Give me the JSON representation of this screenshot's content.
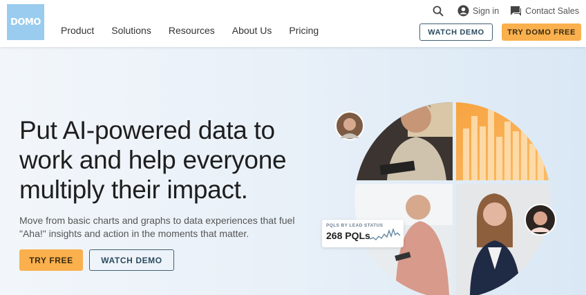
{
  "header": {
    "logo_text": "DOMO",
    "nav": [
      "Product",
      "Solutions",
      "Resources",
      "About Us",
      "Pricing"
    ],
    "search_icon": "search-icon",
    "signin_label": "Sign in",
    "contact_label": "Contact Sales",
    "watch_demo_label": "WATCH DEMO",
    "try_free_label": "TRY DOMO FREE"
  },
  "hero": {
    "headline": "Put AI-powered data to work and help everyone multiply their impact.",
    "subtext": "Move from basic charts and graphs to data experiences that fuel \"Aha!\" insights and action in the moments that matter.",
    "try_free_label": "TRY FREE",
    "watch_demo_label": "WATCH DEMO",
    "pql_card": {
      "title": "PQLS BY LEAD STATUS",
      "value": "268 PQLs"
    }
  },
  "colors": {
    "accent_orange": "#f9b04d",
    "logo_blue": "#99ccee",
    "outline_navy": "#3f5f73"
  }
}
